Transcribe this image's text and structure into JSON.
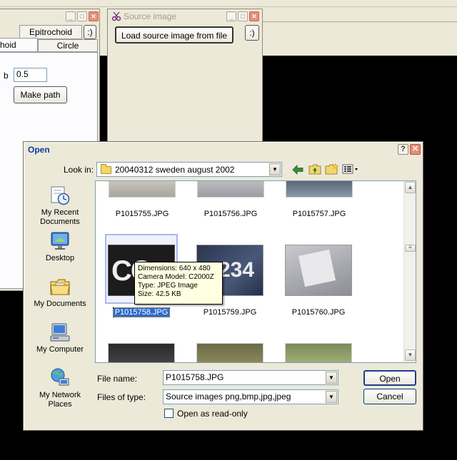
{
  "left_tool": {
    "tabs": [
      "Epitrochoid",
      "hoid",
      "Circle"
    ],
    "smiley": ":)",
    "param_label": "b",
    "param_value": "0.5",
    "make_path": "Make path"
  },
  "source_tool": {
    "title": "Source image",
    "load_button": "Load source image from file",
    "smiley": ":)"
  },
  "dialog": {
    "title": "Open",
    "help": "?",
    "close": "✕",
    "look_in_label": "Look in:",
    "look_in_value": "20040312 sweden august 2002",
    "places": [
      "My Recent Documents",
      "Desktop",
      "My Documents",
      "My Computer",
      "My Network Places"
    ],
    "files": [
      "P1015755.JPG",
      "P1015756.JPG",
      "P1015757.JPG",
      "P1015758.JPG",
      "P1015759.JPG",
      "P1015760.JPG"
    ],
    "tooltip": {
      "dimensions": "Dimensions: 640 x 480",
      "camera": "Camera Model: C2000Z",
      "type": "Type: JPEG Image",
      "size": "Size: 42.5 KB"
    },
    "file_name_label": "File name:",
    "file_name_value": "P1015758.JPG",
    "file_type_label": "Files of type:",
    "file_type_value": "Source images png,bmp,jpg,jpeg",
    "readonly_label": "Open as read-only",
    "open_button": "Open",
    "cancel_button": "Cancel"
  },
  "thumb_text": {
    "t4": "CO",
    "t5": "234"
  }
}
